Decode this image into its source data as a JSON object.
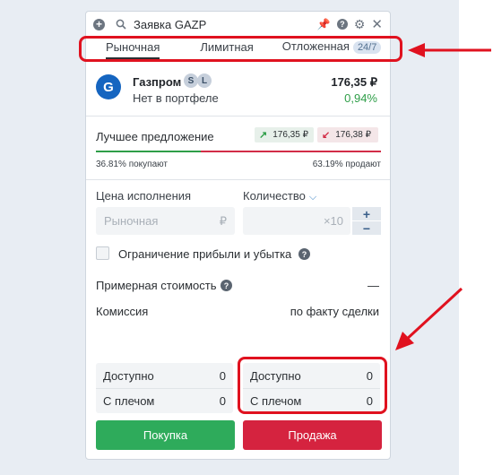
{
  "window": {
    "title": "Заявка GAZP"
  },
  "tabs": [
    {
      "label": "Рыночная",
      "active": true
    },
    {
      "label": "Лимитная",
      "active": false
    },
    {
      "label": "Отложенная",
      "badge": "24/7",
      "active": false
    }
  ],
  "instrument": {
    "name": "Газпром",
    "badges": [
      "S",
      "L"
    ],
    "portfolio_status": "Нет в портфеле",
    "price": "176,35 ₽",
    "change": "0,94%"
  },
  "best_offer": {
    "label": "Лучшее предложение",
    "buy_price": "176,35 ₽",
    "sell_price": "176,38 ₽",
    "buy_share": 36.81,
    "sell_share": 63.19,
    "buy_text": "36.81% покупают",
    "sell_text": "63.19% продают"
  },
  "form": {
    "price_label": "Цена исполнения",
    "price_placeholder": "Рыночная",
    "currency": "₽",
    "qty_label": "Количество",
    "qty_multiplier": "×10",
    "step_plus": "+",
    "step_minus": "−",
    "limit_checkbox_label": "Ограничение прибыли и убытка",
    "limit_checked": false,
    "estimate_label": "Примерная стоимость",
    "estimate_value": "—",
    "fee_label": "Комиссия",
    "fee_value": "по факту сделки"
  },
  "balances": {
    "buy": {
      "available_label": "Доступно",
      "available": "0",
      "leverage_label": "С плечом",
      "leverage": "0"
    },
    "sell": {
      "available_label": "Доступно",
      "available": "0",
      "leverage_label": "С плечом",
      "leverage": "0"
    }
  },
  "actions": {
    "buy_label": "Покупка",
    "sell_label": "Продажа"
  },
  "colors": {
    "buy": "#2eab5b",
    "sell": "#d5233f",
    "highlight": "#e0121f",
    "accent": "#3b82c4"
  },
  "icons": [
    "plus-icon",
    "search-icon",
    "pin-icon",
    "help-icon",
    "gear-icon",
    "close-icon",
    "chevron-down-icon",
    "arrow-up-icon",
    "arrow-down-icon"
  ]
}
